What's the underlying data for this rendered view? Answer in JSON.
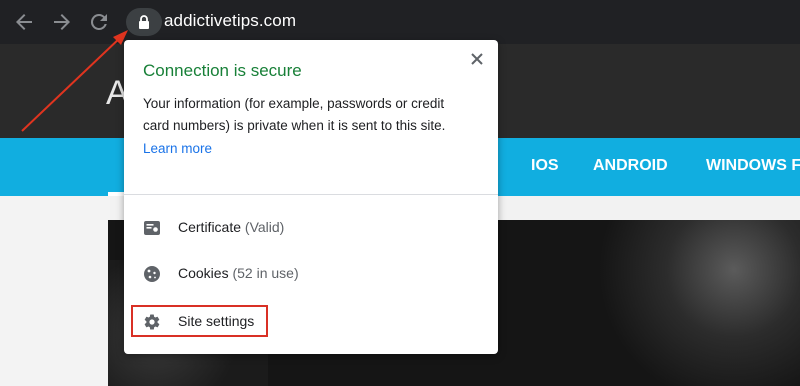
{
  "browser": {
    "url": "addictivetips.com"
  },
  "site": {
    "logo_fragment": "A",
    "nav_items": [
      "IOS",
      "ANDROID",
      "WINDOWS F"
    ]
  },
  "popup": {
    "title": "Connection is secure",
    "description": "Your information (for example, passwords or credit card numbers) is private when it is sent to this site.",
    "learn_more": "Learn more",
    "certificate_label": "Certificate",
    "certificate_status": "(Valid)",
    "cookies_label": "Cookies",
    "cookies_status": "(52 in use)",
    "site_settings_label": "Site settings"
  },
  "colors": {
    "secure_green": "#188038",
    "link_blue": "#1a73e8",
    "nav_blue": "#11aee0",
    "highlight_red": "#d93025",
    "toolbar": "#202124"
  },
  "icons": [
    "back-icon",
    "forward-icon",
    "reload-icon",
    "lock-icon",
    "close-icon",
    "certificate-icon",
    "cookie-icon",
    "gear-icon"
  ]
}
